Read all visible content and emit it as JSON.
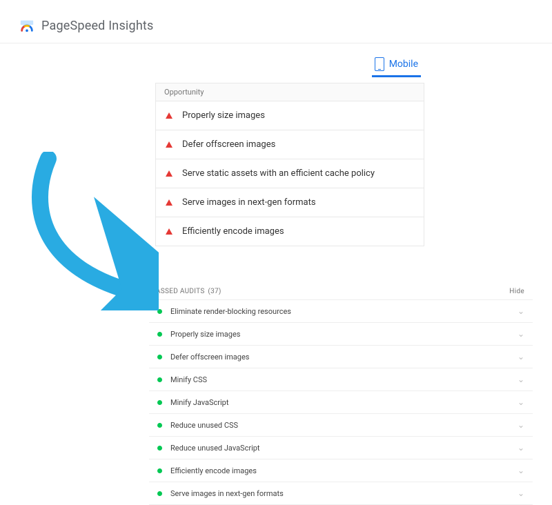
{
  "header": {
    "title": "PageSpeed Insights"
  },
  "tab": {
    "mobile": "Mobile"
  },
  "opportunity": {
    "section_label": "Opportunity",
    "items": [
      "Properly size images",
      "Defer offscreen images",
      "Serve static assets with an efficient cache policy",
      "Serve images in next-gen formats",
      "Efficiently encode images"
    ]
  },
  "passed": {
    "section_label": "PASSED AUDITS",
    "count": "(37)",
    "hide_label": "Hide",
    "items": [
      "Eliminate render-blocking resources",
      "Properly size images",
      "Defer offscreen images",
      "Minify CSS",
      "Minify JavaScript",
      "Reduce unused CSS",
      "Reduce unused JavaScript",
      "Efficiently encode images",
      "Serve images in next-gen formats"
    ]
  }
}
